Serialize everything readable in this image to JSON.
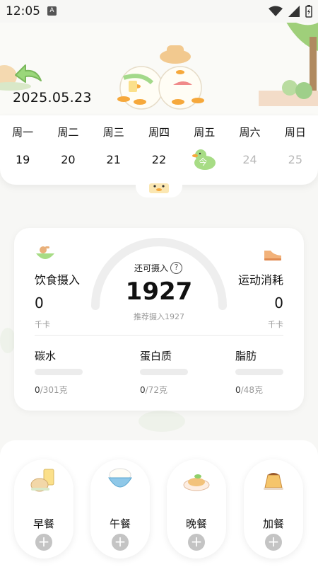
{
  "status_bar": {
    "time": "12:05",
    "notification_badge": "A"
  },
  "header": {
    "date": "2025.05.23"
  },
  "week": {
    "labels": [
      "周一",
      "周二",
      "周三",
      "周四",
      "周五",
      "周六",
      "周日"
    ],
    "days": [
      "19",
      "20",
      "21",
      "22",
      "今",
      "24",
      "25"
    ],
    "today_label": "今"
  },
  "summary": {
    "intake_title": "饮食摄入",
    "intake_value": "0",
    "intake_unit": "千卡",
    "remaining_label": "还可摄入",
    "help_label": "?",
    "remaining_value": "1927",
    "recommended_text": "推荐摄入1927",
    "exercise_title": "运动消耗",
    "exercise_value": "0",
    "exercise_unit": "千卡"
  },
  "macros": [
    {
      "name": "碳水",
      "current": "0",
      "target": "/301克"
    },
    {
      "name": "蛋白质",
      "current": "0",
      "target": "/72克"
    },
    {
      "name": "脂肪",
      "current": "0",
      "target": "/48克"
    }
  ],
  "meals": [
    {
      "label": "早餐",
      "icon": "breakfast-icon"
    },
    {
      "label": "午餐",
      "icon": "lunch-icon"
    },
    {
      "label": "晚餐",
      "icon": "dinner-icon"
    },
    {
      "label": "加餐",
      "icon": "snack-icon"
    }
  ],
  "add_symbol": "+",
  "colors": {
    "accent_green": "#8fcf6a",
    "gauge_track": "#eeeeee",
    "bar_track": "#ececec"
  }
}
